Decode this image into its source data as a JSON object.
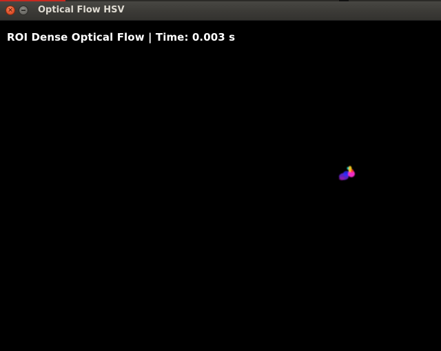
{
  "window": {
    "title": "Optical Flow HSV"
  },
  "controls": {
    "close_icon": "close-icon",
    "minimize_icon": "minimize-icon",
    "close_glyph": "×"
  },
  "overlay": {
    "status_text": "ROI Dense Optical Flow | Time: 0.003 s"
  },
  "colors": {
    "canvas_background": "#000000",
    "overlay_text": "#ffffff",
    "titlebar": "#3c3b37",
    "close_button": "#e0502a",
    "minimize_button": "#6d6c67",
    "flow_hues": [
      "#ff2fd0",
      "#7a2cff",
      "#ffd21a",
      "#2a2cff",
      "#ff3a2a",
      "#14d8c8"
    ]
  }
}
